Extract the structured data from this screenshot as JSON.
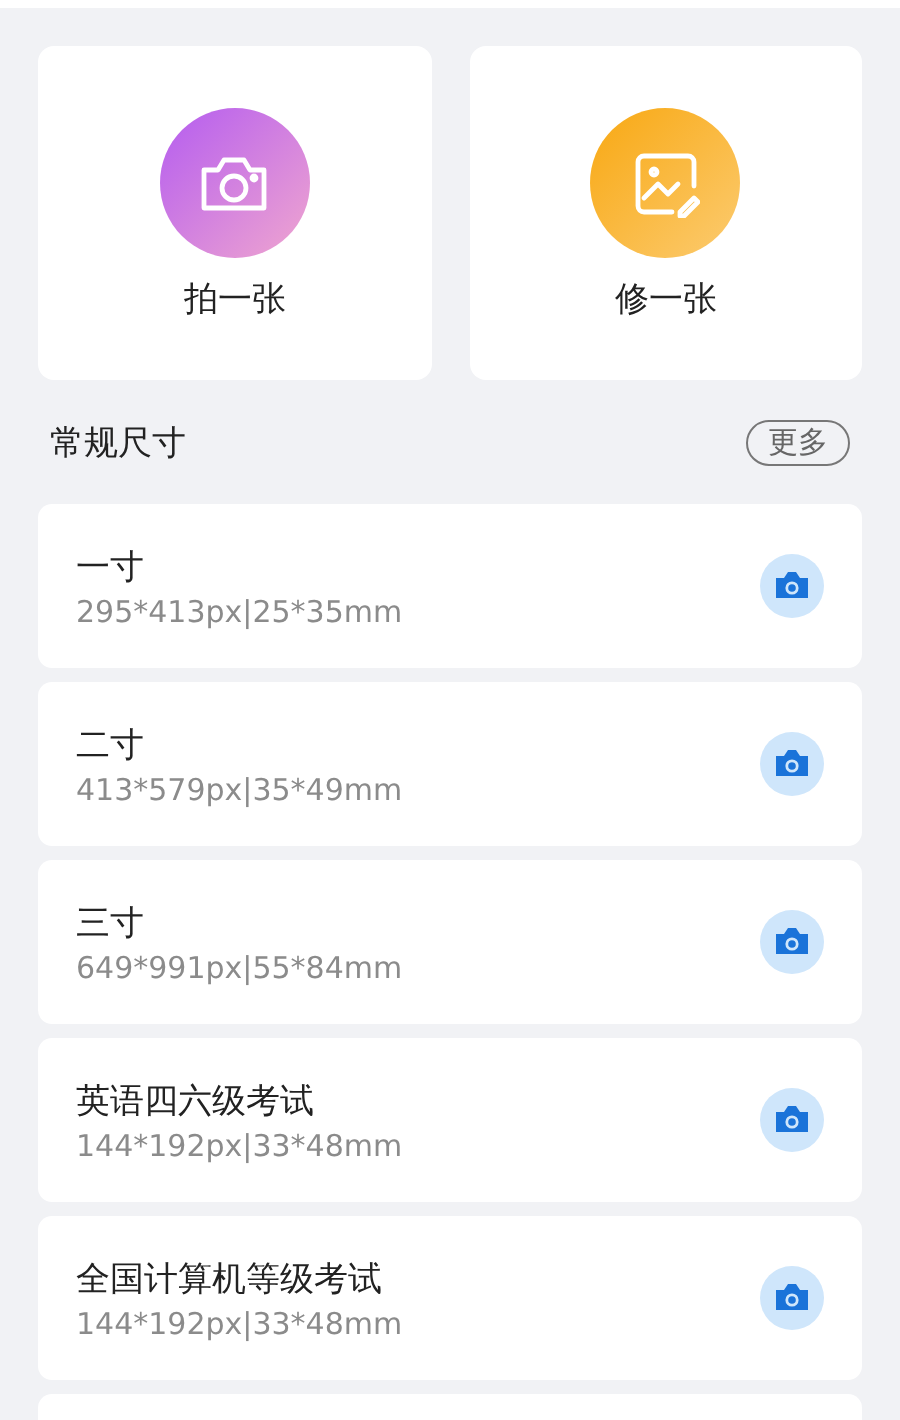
{
  "actions": [
    {
      "kind": "camera",
      "label": "拍一张"
    },
    {
      "kind": "edit",
      "label": "修一张"
    }
  ],
  "section": {
    "title": "常规尺寸",
    "more": "更多"
  },
  "sizes": [
    {
      "name": "一寸",
      "spec": "295*413px|25*35mm"
    },
    {
      "name": "二寸",
      "spec": "413*579px|35*49mm"
    },
    {
      "name": "三寸",
      "spec": "649*991px|55*84mm"
    },
    {
      "name": "英语四六级考试",
      "spec": "144*192px|33*48mm"
    },
    {
      "name": "全国计算机等级考试",
      "spec": "144*192px|33*48mm"
    }
  ]
}
